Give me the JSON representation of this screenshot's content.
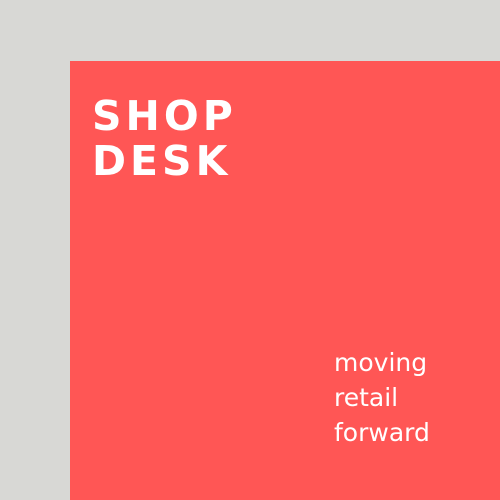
{
  "colors": {
    "background": "#d8d8d5",
    "panel": "#ff5655",
    "text": "#ffffff"
  },
  "brand": {
    "lines": [
      "SHOP",
      "DESK"
    ]
  },
  "tagline": {
    "lines": [
      "moving",
      "retail",
      "forward"
    ]
  }
}
